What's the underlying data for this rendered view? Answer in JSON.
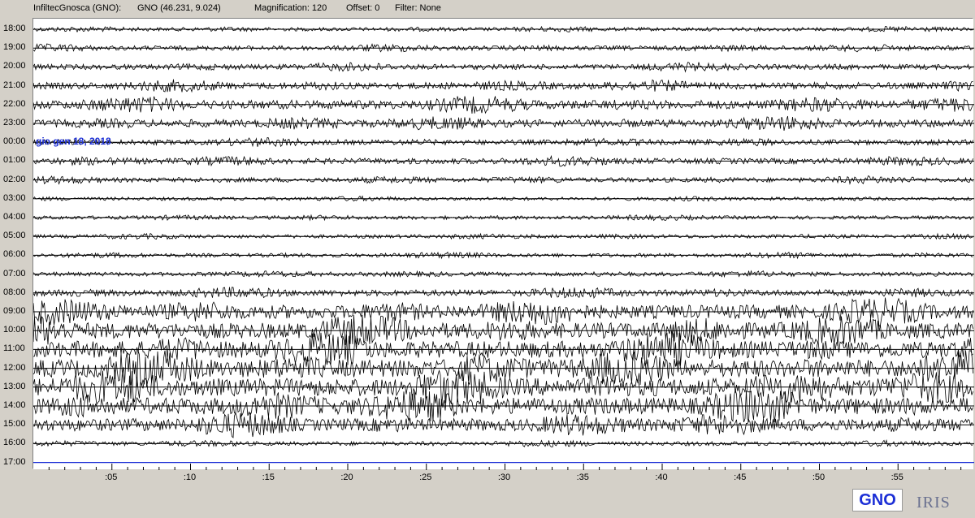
{
  "header": {
    "station": "InfiltecGnosca (GNO):",
    "code_coords": "GNO (46.231, 9.024)",
    "magnification": "Magnification: 120",
    "offset": "Offset: 0",
    "filter": "Filter: None"
  },
  "date_label": "gio gen 18, 2018",
  "hour_labels": [
    "18:00",
    "19:00",
    "20:00",
    "21:00",
    "22:00",
    "23:00",
    "00:00",
    "01:00",
    "02:00",
    "03:00",
    "04:00",
    "05:00",
    "06:00",
    "07:00",
    "08:00",
    "09:00",
    "10:00",
    "11:00",
    "12:00",
    "13:00",
    "14:00",
    "15:00",
    "16:00",
    "17:00"
  ],
  "minute_labels": [
    ":05",
    ":10",
    ":15",
    ":20",
    ":25",
    ":30",
    ":35",
    ":40",
    ":45",
    ":50",
    ":55"
  ],
  "trace_activity": [
    0.3,
    0.5,
    0.6,
    0.9,
    1.3,
    1.1,
    0.6,
    0.7,
    0.5,
    0.25,
    0.3,
    0.3,
    0.35,
    0.4,
    0.8,
    2.2,
    2.6,
    2.8,
    3.0,
    3.0,
    2.8,
    2.0,
    0.4,
    0.0
  ],
  "colors": {
    "trace": "#000000",
    "current_hour": "#1c2fd6",
    "date_label": "#1c2fd6"
  },
  "logos": {
    "gno": "GNO",
    "iris": "IRIS"
  }
}
